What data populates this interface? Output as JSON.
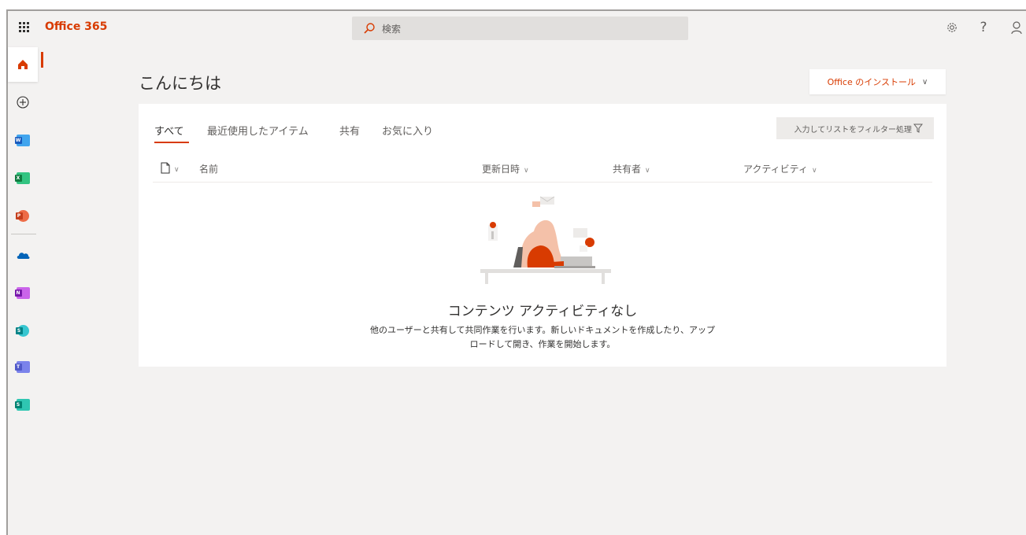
{
  "header": {
    "brand": "Office 365",
    "search_placeholder": "検索"
  },
  "main": {
    "greeting": "こんにちは",
    "install_label": "Office のインストール"
  },
  "tabs": [
    {
      "label": "すべて",
      "active": true
    },
    {
      "label": "最近使用したアイテム",
      "active": false
    },
    {
      "label": "共有",
      "active": false
    },
    {
      "label": "お気に入り",
      "active": false
    }
  ],
  "filter": {
    "placeholder": "入力してリストをフィルター処理"
  },
  "columns": {
    "name": "名前",
    "modified": "更新日時",
    "shared_by": "共有者",
    "activity": "アクティビティ"
  },
  "empty_state": {
    "title": "コンテンツ アクティビティなし",
    "line1": "他のユーザーと共有して共同作業を行います。新しいドキュメントを作成したり、アップ",
    "line2": "ロードして開き、作業を開始します。"
  },
  "rail_apps": [
    {
      "icon": "home-icon"
    },
    {
      "icon": "create-icon"
    },
    {
      "icon": "word-icon",
      "color": "#185abd"
    },
    {
      "icon": "excel-icon",
      "color": "#107c41"
    },
    {
      "icon": "powerpoint-icon",
      "color": "#c43e1c"
    },
    {
      "icon": "onedrive-icon",
      "color": "#0364b8"
    },
    {
      "icon": "onenote-icon",
      "color": "#7719aa"
    },
    {
      "icon": "sharepoint-icon",
      "color": "#038387"
    },
    {
      "icon": "teams-icon",
      "color": "#5059c9"
    },
    {
      "icon": "sway-icon",
      "color": "#008272"
    }
  ],
  "colors": {
    "accent": "#d83b01",
    "background": "#f3f2f1"
  }
}
